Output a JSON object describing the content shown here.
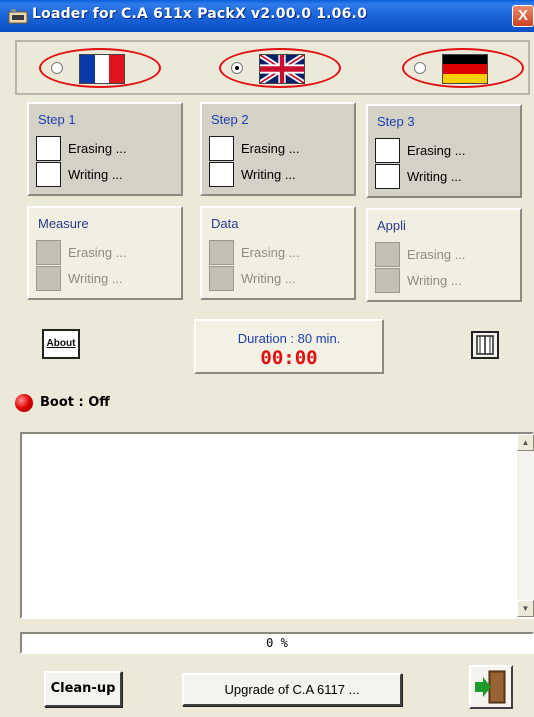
{
  "window": {
    "title": "Loader for C.A 611x  PackX v2.00.0  1.06.0",
    "close": "X"
  },
  "languages": [
    {
      "name": "french",
      "selected": false
    },
    {
      "name": "english",
      "selected": true
    },
    {
      "name": "german",
      "selected": false
    }
  ],
  "steps": [
    {
      "title": "Step 1",
      "erasing": "Erasing ...",
      "writing": "Writing ..."
    },
    {
      "title": "Step 2",
      "erasing": "Erasing ...",
      "writing": "Writing ..."
    },
    {
      "title": "Step 3",
      "erasing": "Erasing ...",
      "writing": "Writing ..."
    }
  ],
  "sections": [
    {
      "title": "Measure",
      "erasing": "Erasing ...",
      "writing": "Writing ..."
    },
    {
      "title": "Data",
      "erasing": "Erasing ...",
      "writing": "Writing ..."
    },
    {
      "title": "Appli",
      "erasing": "Erasing ...",
      "writing": "Writing ..."
    }
  ],
  "about_label": "About",
  "duration": {
    "label": "Duration : 80 min.",
    "timer": "00:00"
  },
  "boot": {
    "label": "Boot : Off",
    "status_color": "#e00000"
  },
  "log": {
    "text": ""
  },
  "progress": {
    "text": "0 %",
    "value": 0
  },
  "buttons": {
    "cleanup": "Clean-up",
    "upgrade": "Upgrade of C.A 6117 ..."
  }
}
